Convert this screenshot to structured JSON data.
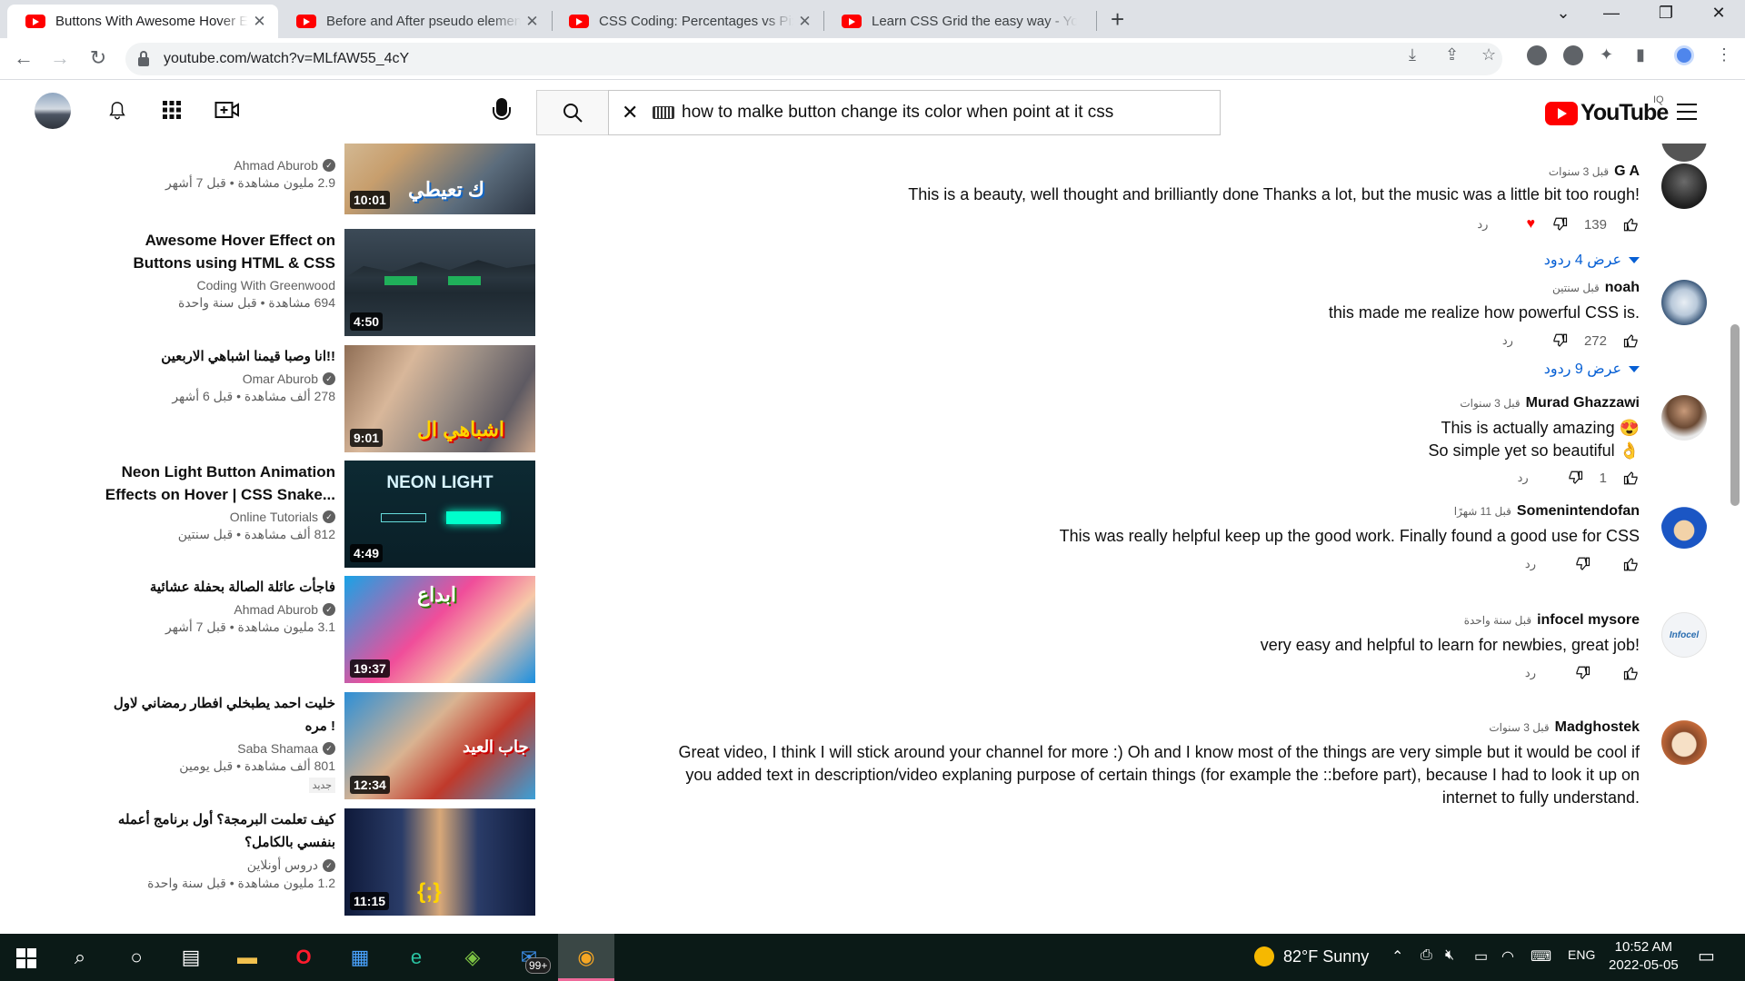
{
  "browser": {
    "tabs": [
      {
        "title": "Buttons With Awesome Hover Effects",
        "active": true
      },
      {
        "title": "Before and After pseudo elements",
        "active": false
      },
      {
        "title": "CSS Coding: Percentages vs Pixels",
        "active": false
      },
      {
        "title": "Learn CSS Grid the easy way - YouTube",
        "active": false
      }
    ],
    "url": "youtube.com/watch?v=MLfAW55_4cY"
  },
  "header": {
    "search_query": "how to malke button change its color when point at it css",
    "logo_text": "YouTube",
    "country_code": "IQ"
  },
  "related": [
    {
      "title": "",
      "channel": "Ahmad Aburob",
      "meta": "2.9 مليون مشاهدة • قبل 7 أشهر",
      "duration": "10:01",
      "thumb": "thumb-1"
    },
    {
      "title": "Awesome Hover Effect on Buttons using HTML & CSS",
      "channel": "Coding With Greenwood",
      "meta": "694 مشاهدة • قبل سنة واحدة",
      "duration": "4:50",
      "thumb": "thumb-2"
    },
    {
      "title": "انا وصبا قيمنا اشباهي الاربعين!!",
      "channel": "Omar Aburob",
      "meta": "278 ألف مشاهدة • قبل 6 أشهر",
      "duration": "9:01",
      "thumb": "thumb-3"
    },
    {
      "title": "Neon Light Button Animation Effects on Hover | CSS Snake...",
      "channel": "Online Tutorials",
      "meta": "812 ألف مشاهدة • قبل سنتين",
      "duration": "4:49",
      "thumb": "thumb-4"
    },
    {
      "title": "فاجأت عائلة الصالة بحفلة عشائية",
      "channel": "Ahmad Aburob",
      "meta": "3.1 مليون مشاهدة • قبل 7 أشهر",
      "duration": "19:37",
      "thumb": "thumb-5"
    },
    {
      "title": "خليت احمد يطبخلي افطار رمضاني لاول مره !",
      "channel": "Saba Shamaa",
      "meta": "801 ألف مشاهدة • قبل يومين",
      "duration": "12:34",
      "thumb": "thumb-6",
      "badge": "جديد"
    },
    {
      "title": "كيف تعلمت البرمجة؟ أول برنامج أعمله بنفسي بالكامل؟",
      "channel": "دروس أونلاين",
      "meta": "1.2 مليون مشاهدة • قبل سنة واحدة",
      "duration": "11:15",
      "thumb": "thumb-7"
    }
  ],
  "comments": [
    {
      "author": "G A",
      "time": "قبل 3 سنوات",
      "text": "This is a beauty, well thought and brilliantly done Thanks a lot, but the music was a little bit too rough!",
      "likes": "139",
      "reply_label": "رد",
      "replies": "عرض 4 ردود",
      "hearted": true
    },
    {
      "author": "noah",
      "time": "قبل سنتين",
      "text": "this made me realize how powerful CSS is.",
      "likes": "272",
      "reply_label": "رد",
      "replies": "عرض 9 ردود"
    },
    {
      "author": "Murad Ghazzawi",
      "time": "قبل 3 سنوات",
      "text": "This is actually amazing 😍\nSo simple yet so beautiful 👌",
      "likes": "1",
      "reply_label": "رد"
    },
    {
      "author": "Somenintendofan",
      "time": "قبل 11 شهرًا",
      "text": "This was really helpful keep up the good work. Finally found a good use for CSS",
      "likes": "",
      "reply_label": "رد"
    },
    {
      "author": "infocel mysore",
      "time": "قبل سنة واحدة",
      "text": "very easy and helpful to learn  for newbies, great job!",
      "likes": "",
      "reply_label": "رد"
    },
    {
      "author": "Madghostek",
      "time": "قبل 3 سنوات",
      "text": "Great video, I think I will stick around your channel for more :) Oh and I know most of the things are very simple but it would be cool if you added text in description/video explaning purpose of certain things (for example the ::before part), because I had to look it up on internet to fully understand.",
      "likes": "",
      "reply_label": ""
    }
  ],
  "taskbar": {
    "weather": "82°F  Sunny",
    "notification_count": "99+",
    "language": "ENG",
    "time": "10:52 AM",
    "date": "2022-05-05"
  }
}
